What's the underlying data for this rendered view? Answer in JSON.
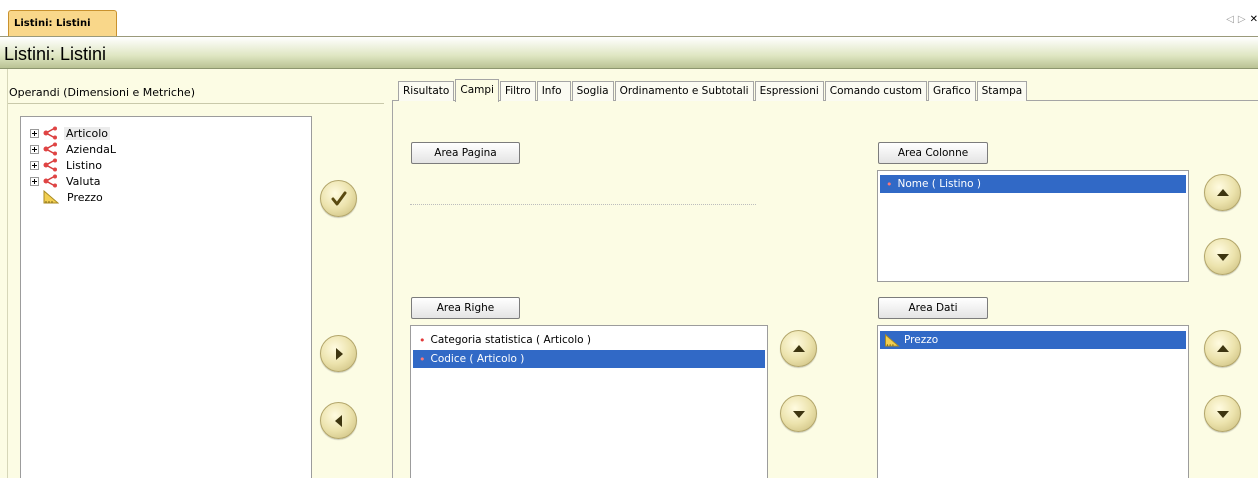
{
  "document_tab": {
    "label": "Listini: Listini"
  },
  "tabstrip_nav": {
    "prev": "◁",
    "next": "▷",
    "close": "✕"
  },
  "title": "Listini: Listini",
  "operandi": {
    "title": "Operandi (Dimensioni e Metriche)",
    "items": [
      {
        "label": "Articolo",
        "type": "dimension",
        "selected": true
      },
      {
        "label": "AziendaL",
        "type": "dimension",
        "selected": false
      },
      {
        "label": "Listino",
        "type": "dimension",
        "selected": false
      },
      {
        "label": "Valuta",
        "type": "dimension",
        "selected": false
      },
      {
        "label": "Prezzo",
        "type": "metric",
        "selected": false
      }
    ]
  },
  "tabs": [
    {
      "label": "Risultato",
      "active": false
    },
    {
      "label": "Campi",
      "active": true
    },
    {
      "label": "Filtro",
      "active": false
    },
    {
      "label": "Info",
      "active": false
    },
    {
      "label": "Soglia",
      "active": false
    },
    {
      "label": "Ordinamento e Subtotali",
      "active": false
    },
    {
      "label": "Espressioni",
      "active": false
    },
    {
      "label": "Comando custom",
      "active": false
    },
    {
      "label": "Grafico",
      "active": false
    },
    {
      "label": "Stampa",
      "active": false
    }
  ],
  "areas": {
    "pagina": {
      "button": "Area Pagina"
    },
    "colonne": {
      "button": "Area Colonne",
      "items": [
        "Nome ( Listino )"
      ]
    },
    "righe": {
      "button": "Area Righe",
      "items": [
        "Categoria statistica ( Articolo )",
        "Codice ( Articolo )"
      ]
    },
    "dati": {
      "button": "Area Dati",
      "items": [
        "Prezzo"
      ]
    }
  },
  "colors": {
    "selection": "#3169c6",
    "panel_background": "#fcfce4",
    "document_tab": "#f9d78a"
  }
}
